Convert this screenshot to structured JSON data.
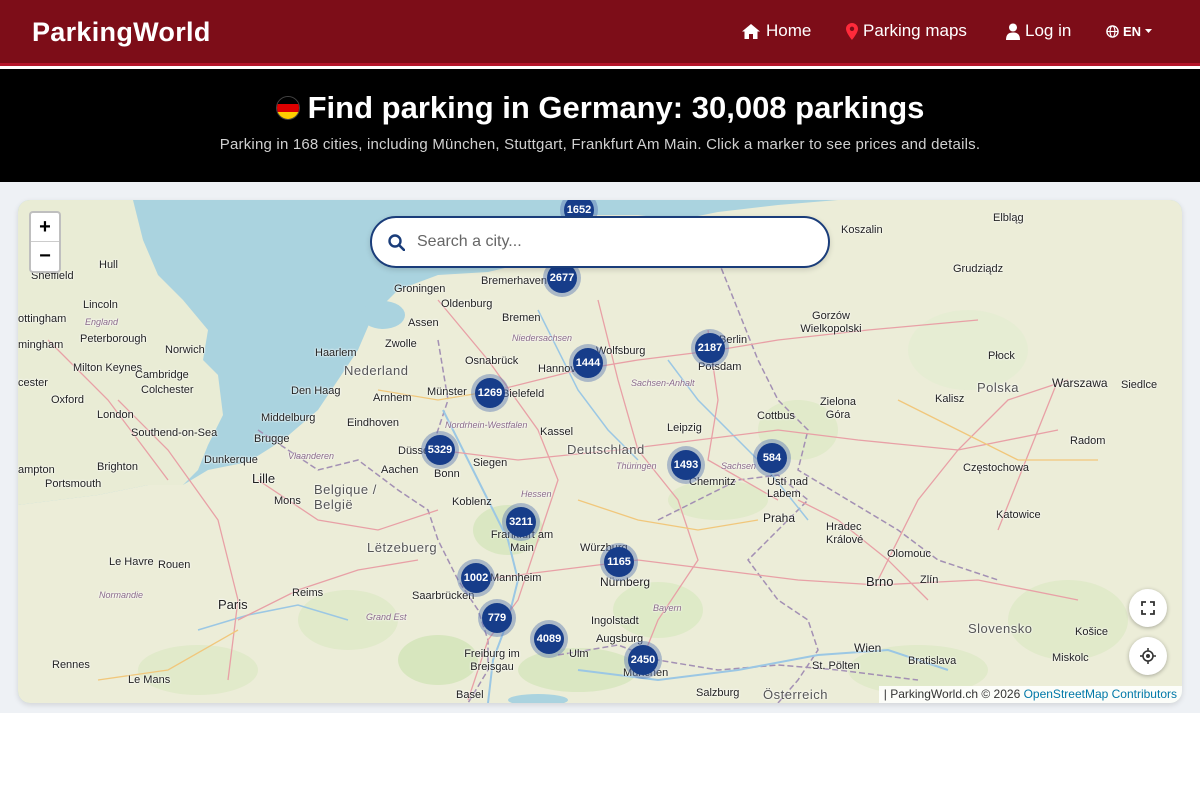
{
  "brand": "ParkingWorld",
  "nav": {
    "home": "Home",
    "parking_maps": "Parking maps",
    "login": "Log in",
    "language": "EN"
  },
  "hero": {
    "title": "Find parking in Germany: 30,008 parkings",
    "subtitle": "Parking in 168 cities, including München, Stuttgart, Frankfurt Am Main. Click a marker to see prices and details."
  },
  "search": {
    "placeholder": "Search a city..."
  },
  "zoom": {
    "in": "+",
    "out": "−"
  },
  "attribution": {
    "prefix": "| ParkingWorld.ch © 2026 ",
    "link": "OpenStreetMap Contributors"
  },
  "clusters": [
    "1652",
    "2677",
    "1444",
    "2187",
    "1269",
    "5329",
    "1493",
    "584",
    "3211",
    "1165",
    "1002",
    "779",
    "4089",
    "2450"
  ],
  "places": {
    "sheffield": "Sheffield",
    "hull": "Hull",
    "lincoln": "Lincoln",
    "nottingham": "ottingham",
    "england": "England",
    "peterborough": "Peterborough",
    "norwich": "Norwich",
    "birmingham": "mingham",
    "milton_keynes": "Milton Keynes",
    "cambridge": "Cambridge",
    "colchester": "Colchester",
    "oxford": "Oxford",
    "leicester": "cester",
    "london": "London",
    "southend": "Southend-on-Sea",
    "brighton": "Brighton",
    "southampton": "ampton",
    "portsmouth": "Portsmouth",
    "groningen": "Groningen",
    "oldenburg": "Oldenburg",
    "assen": "Assen",
    "bremen": "Bremen",
    "bremerhaven": "Bremerhaven",
    "zwolle": "Zwolle",
    "haarlem": "Haarlem",
    "nederland": "Nederland",
    "osnabruck": "Osnabrück",
    "niedersachsen": "Niedersachsen",
    "wolfsburg": "Wolfsburg",
    "hannover": "Hannover",
    "berlin": "Berlin",
    "potsdam": "Potsdam",
    "den_haag": "Den Haag",
    "arnhem": "Arnhem",
    "munster": "Münster",
    "bielefeld": "Bielefeld",
    "sachsen_anhalt": "Sachsen-Anhalt",
    "middelburg": "Middelburg",
    "eindhoven": "Eindhoven",
    "nordrhein": "Nordrhein-Westfalen",
    "kassel": "Kassel",
    "leipzig": "Leipzig",
    "cottbus": "Cottbus",
    "brugge": "Brugge",
    "dusseldorf": "Düsseldorf",
    "deutschland": "Deutschland",
    "vlaanderen": "Vlaanderen",
    "dunkerque": "Dunkerque",
    "aachen": "Aachen",
    "bonn": "Bonn",
    "siegen": "Siegen",
    "thuringen": "Thüringen",
    "sachsen": "Sachsen",
    "chemnitz": "Chemnitz",
    "usti": "Ústí nad Labem",
    "lille": "Lille",
    "belgique": "Belgique / België",
    "mons": "Mons",
    "koblenz": "Koblenz",
    "hessen": "Hessen",
    "frankfurt": "Frankfurt am Main",
    "praha": "Praha",
    "letzebuerg": "Lëtzebuerg",
    "wurzburg": "Würzburg",
    "hradec": "Hradec Králové",
    "olomouc": "Olomouc",
    "le_havre": "Le Havre",
    "rouen": "Rouen",
    "mannheim": "Mannheim",
    "nurnberg": "Nürnberg",
    "brno": "Brno",
    "zlin": "Zlín",
    "paris": "Paris",
    "reims": "Reims",
    "saarbrucken": "Saarbrücken",
    "ingolstadt": "Ingolstadt",
    "bayern": "Bayern",
    "grand_est": "Grand Est",
    "augsburg": "Augsburg",
    "ulm": "Ulm",
    "munchen": "München",
    "wien": "Wien",
    "bratislava": "Bratislava",
    "freiburg": "Freiburg im Breisgau",
    "rennes": "Rennes",
    "le_mans": "Le Mans",
    "basel": "Basel",
    "salzburg": "Salzburg",
    "osterreich": "Österreich",
    "st_polten": "St. Pölten",
    "slovensko": "Slovensko",
    "kosice": "Košice",
    "miskolc": "Miskolc",
    "katowice": "Katowice",
    "czestochowa": "Częstochowa",
    "radom": "Radom",
    "warszawa": "Warszawa",
    "polska": "Polska",
    "plock": "Płock",
    "siedlce": "Siedlce",
    "kalisz": "Kalisz",
    "zielona_gora": "Zielona Góra",
    "gorzow": "Gorzów Wielkopolski",
    "koszalin": "Koszalin",
    "elblag": "Elbląg",
    "grudziadz": "Grudziądz",
    "normandie": "Normandie"
  },
  "colors": {
    "nav_bg": "#7d0d18",
    "accent_border": "#b5152a",
    "cluster": "#173d8a",
    "search_border": "#1a3d7a"
  }
}
